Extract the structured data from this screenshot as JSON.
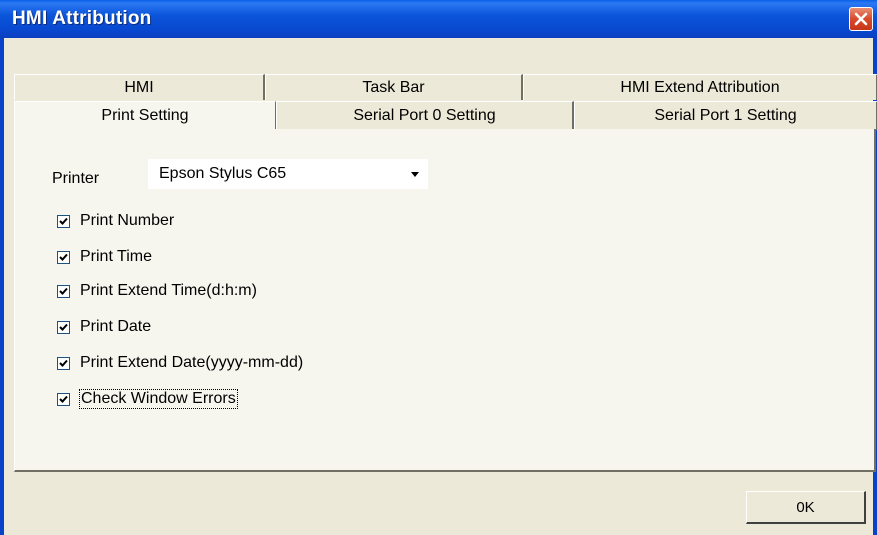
{
  "window": {
    "title": "HMI Attribution"
  },
  "tabs": {
    "back_row": [
      "HMI",
      "Task Bar",
      "HMI Extend Attribution"
    ],
    "front_row": [
      "Print Setting",
      "Serial Port 0 Setting",
      "Serial Port 1 Setting"
    ],
    "active": "Print Setting"
  },
  "printer": {
    "label": "Printer",
    "selected": "Epson Stylus C65"
  },
  "options": [
    {
      "label": "Print Number",
      "checked": true
    },
    {
      "label": "Print Time",
      "checked": true
    },
    {
      "label": "Print Extend Time(d:h:m)",
      "checked": true
    },
    {
      "label": "Print Date",
      "checked": true
    },
    {
      "label": "Print Extend Date(yyyy-mm-dd)",
      "checked": true
    },
    {
      "label": "Check Window Errors",
      "checked": true
    }
  ],
  "buttons": {
    "ok": "0K"
  },
  "colors": {
    "titlebar": "#0842C9",
    "close": "#D9492B",
    "face": "#ECE9D8"
  }
}
